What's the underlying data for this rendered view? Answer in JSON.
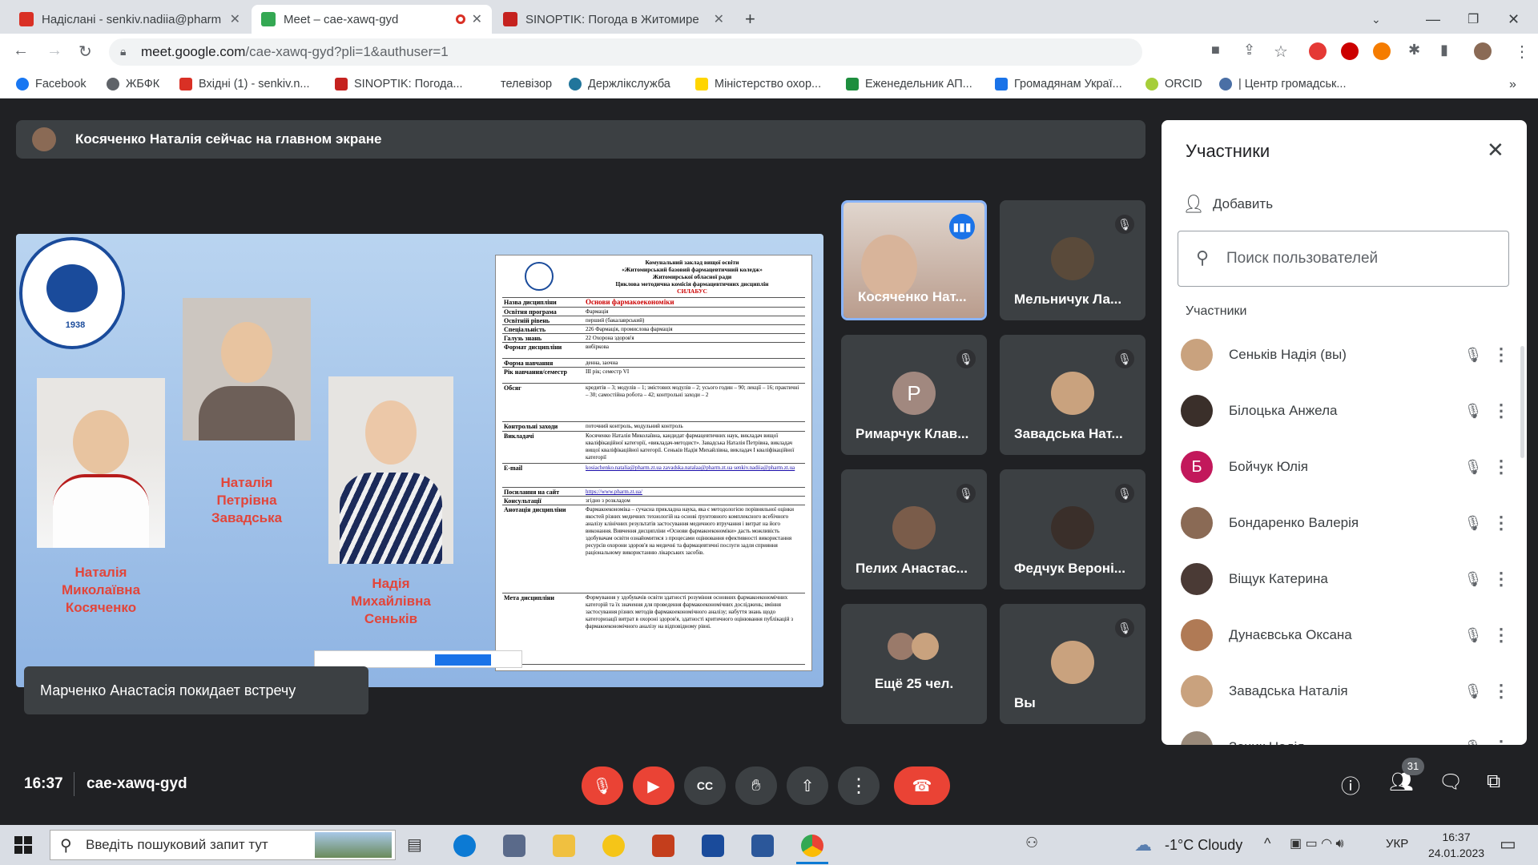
{
  "browser": {
    "tabs": [
      {
        "title": "Надіслані - senkiv.nadiia@pharm",
        "favicon_color": "#d93025"
      },
      {
        "title": "Meet – cae-xawq-gyd",
        "favicon_color": "#34a853"
      },
      {
        "title": "SINOPTIK: Погода в Житомире",
        "favicon_color": "#c5221f"
      }
    ],
    "address_host": "meet.google.com",
    "address_path": "/cae-xawq-gyd?pli=1&authuser=1",
    "bookmarks": [
      "Facebook",
      "ЖБФК",
      "Вхідні (1) - senkiv.n...",
      "SINOPTIK: Погода...",
      "телевізор",
      "Держлікслужба",
      "Міністерство охор...",
      "Еженедельник АП...",
      "Громадянам Украї...",
      "ORCID",
      "| Центр громадськ..."
    ],
    "bookmarks_more": "»"
  },
  "meet": {
    "presenting_banner": "Косяченко Наталія сейчас на главном экране",
    "toast": "Марченко Анастасія покидает встречу",
    "time": "16:37",
    "meeting_code": "cae-xawq-gyd",
    "people_badge": "31"
  },
  "slide": {
    "logo_year": "1938",
    "persons": [
      {
        "name": "Наталія\nМиколаївна\nКосяченко"
      },
      {
        "name": "Наталія\nПетрівна\nЗавадська"
      },
      {
        "name": "Надія\nМихайлівна\nСеньків"
      }
    ],
    "doc_header": [
      "Комунальний заклад вищої освіти",
      "«Житомирський базовий фармацевтичний коледж»",
      "Житомирської обласної ради",
      "Циклова методична комісія фармацевтичних дисциплін",
      "СИЛАБУС"
    ],
    "doc_rows": [
      {
        "k": "Назва дисципліни",
        "v": "Основи фармакоекономіки"
      },
      {
        "k": "Освітня програма",
        "v": "Фармація"
      },
      {
        "k": "Освітній рівень",
        "v": "перший (бакалаврський)"
      },
      {
        "k": "Спеціальність",
        "v": "226 Фармація, промислова фармація"
      },
      {
        "k": "Галузь знань",
        "v": "22 Охорона здоров'я"
      },
      {
        "k": "Формат дисципліни",
        "v": "вибіркова"
      },
      {
        "k": "Форма навчання",
        "v": "денна, заочна"
      },
      {
        "k": "Рік навчання/семестр",
        "v": "ІІІ рік; семестр VІ"
      },
      {
        "k": "Обсяг",
        "v": "кредитів – 3; модулів – 1; змістових модулів – 2; усього годин – 90; лекції – 16; практичні – 30; самостійна робота – 42; контрольні заходи – 2"
      },
      {
        "k": "Контрольні заходи",
        "v": "поточний контроль, модульний контроль"
      },
      {
        "k": "Викладачі",
        "v": "Косяченко Наталія Миколаївна, кандидат фармацевтичних наук, викладач вищої кваліфікаційної категорії, «викладач-методист». Завадська Наталія Петрівна, викладач вищої кваліфікаційної категорії. Сеньків Надія Михайлівна, викладач І кваліфікаційної категорії"
      },
      {
        "k": "E-mail",
        "v": "kosiachenko.natalia@pharm.zt.ua  zavadska.natalaa@pharm.zt.ua  senkiv.nadiia@pharm.zt.ua"
      },
      {
        "k": "Посилання на сайт",
        "v": "https://www.pharm.zt.ua/"
      },
      {
        "k": "Консультації",
        "v": "згідно з розкладом"
      },
      {
        "k": "Анотація дисципліни",
        "v": "Фармакоекономіка – сучасна прикладна наука, яка є методологією порівняльної оцінки якостей різних медичних технологій на основі ґрунтовного комплексного всебічного аналізу клінічних результатів застосування медичного втручання і витрат на його виконання. Вивчення дисципліни «Основи фармакоекономіки» дасть можливість здобувачам освіти ознайомитися з процесами оцінювання ефективності використання ресурсів охорони здоров'я на медичні та фармацевтичні послуги задля сприяння раціональному використанню лікарських засобів."
      },
      {
        "k": "Мета дисципліни",
        "v": "Формування у здобувачів освіти здатності розуміння основних фармакоекономічних категорій та їх значення для проведення фармакоекономічних досліджень; вміння застосування різних методів фармакоекономічного аналізу; набуття знань щодо категоризації витрат в охороні здоров'я, здатності критичного оцінювання публікацій з фармакоекономічного аналізу на відповідному рівні."
      }
    ]
  },
  "tiles": [
    {
      "name": "Косяченко Нат...",
      "speaking": true,
      "color": "#b89a8a"
    },
    {
      "name": "Мельничук Ла...",
      "color": "#5a4a3a"
    },
    {
      "name": "Римарчук Клав...",
      "initial": "Р",
      "color": "#a1887f"
    },
    {
      "name": "Завадська Нат...",
      "color": "#c9a27e"
    },
    {
      "name": "Пелих Анастас...",
      "color": "#7a5c4a"
    },
    {
      "name": "Федчук Вероні...",
      "color": "#3a2f2a"
    },
    {
      "name": "Ещё 25 чел.",
      "color": "#9a7a6a"
    },
    {
      "name": "Вы",
      "color": "#c9a27e"
    }
  ],
  "panel": {
    "title": "Участники",
    "add_label": "Добавить",
    "search_placeholder": "Поиск пользователей",
    "section": "Участники",
    "people": [
      {
        "name": "Сеньків Надія (вы)",
        "color": "#c9a27e"
      },
      {
        "name": "Білоцька Анжела",
        "color": "#3a2f2a"
      },
      {
        "name": "Бойчук Юлія",
        "initial": "Б",
        "color": "#c2185b"
      },
      {
        "name": "Бондаренко Валерія",
        "color": "#8a6a55"
      },
      {
        "name": "Віщук Катерина",
        "color": "#4a3a35"
      },
      {
        "name": "Дунаєвська Оксана",
        "color": "#b07a55"
      },
      {
        "name": "Завадська Наталія",
        "color": "#c9a27e"
      },
      {
        "name": "Зачик Надія",
        "color": "#9a8a7a"
      }
    ]
  },
  "taskbar": {
    "search_placeholder": "Введіть пошуковий запит тут",
    "weather": "-1°C  Cloudy",
    "lang": "УКР",
    "time": "16:37",
    "date": "24.01.2023"
  },
  "colors": {
    "end_call": "#ea4335",
    "accent": "#1a73e8",
    "muted_btn": "#ea4335"
  }
}
